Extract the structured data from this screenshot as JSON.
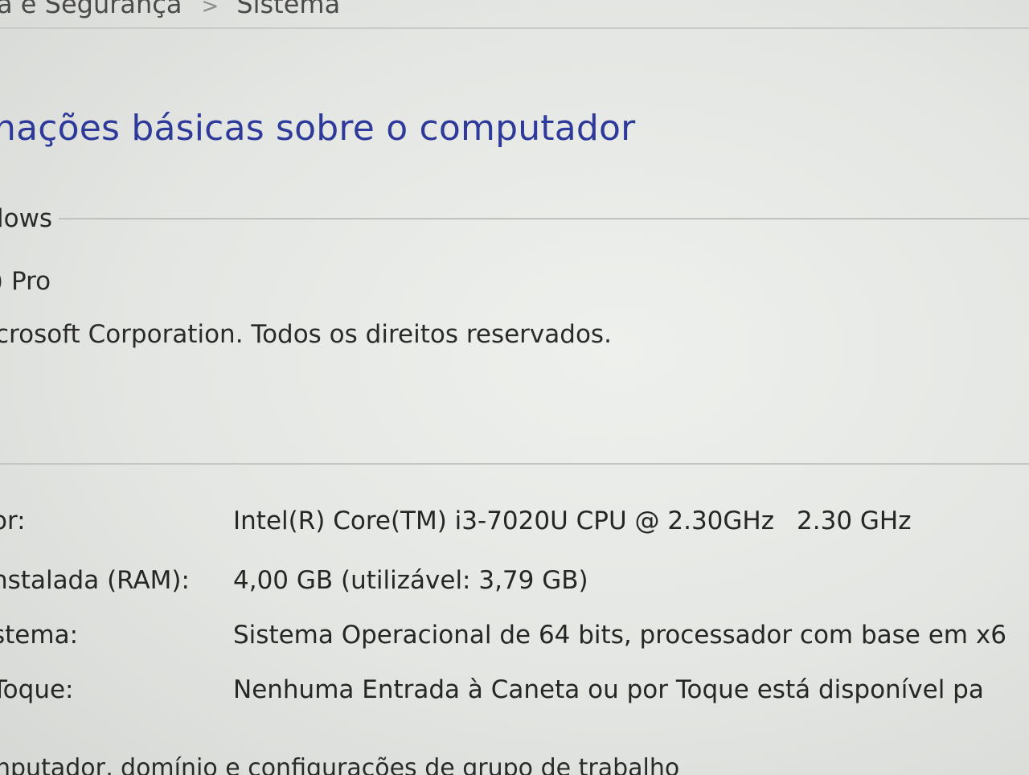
{
  "breadcrumb": {
    "items": [
      "a e Segurança",
      "Sistema"
    ],
    "separator": ">"
  },
  "page_title": "nações básicas sobre o computador",
  "windows_section": {
    "header": "lows",
    "edition": ") Pro",
    "copyright": "crosoft Corporation. Todos os direitos reservados."
  },
  "system_section": {
    "processor": {
      "label": "or:",
      "value": "Intel(R) Core(TM) i3-7020U CPU @ 2.30GHz",
      "frequency": "2.30 GHz"
    },
    "ram": {
      "label": "nstalada (RAM):",
      "value": "4,00 GB (utilizável: 3,79 GB)"
    },
    "system_type": {
      "label": "stema:",
      "value": "Sistema Operacional de 64 bits, processador com base em x6"
    },
    "pen_touch": {
      "label": "Toque:",
      "value": "Nenhuma Entrada à Caneta ou por Toque está disponível pa"
    }
  },
  "next_section_header": "nputador, domínio e configurações de grupo de trabalho",
  "colors": {
    "title_blue": "#2e3a9a",
    "background": "#e6e8e5",
    "text": "#2a2a2a"
  }
}
